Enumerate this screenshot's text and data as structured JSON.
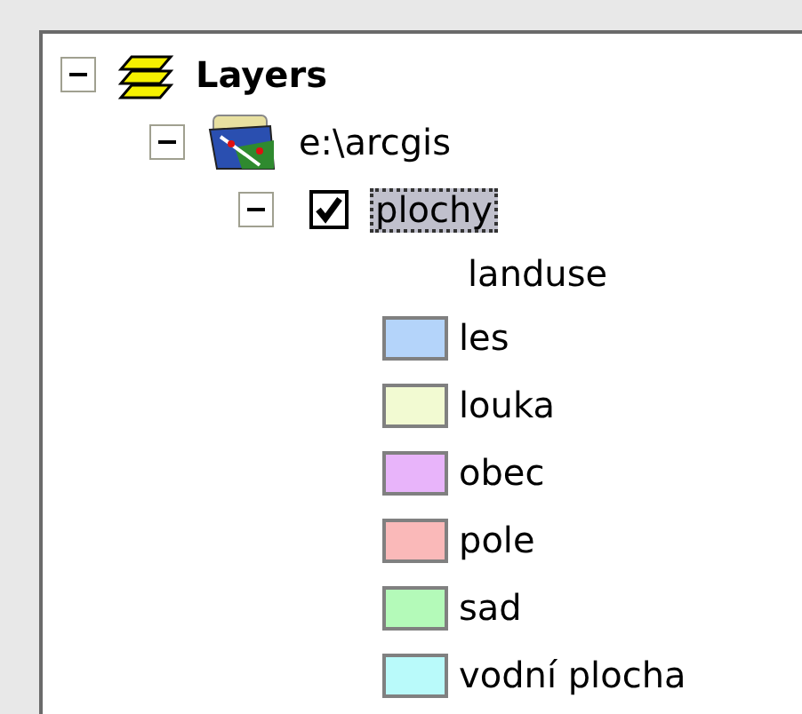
{
  "tree": [
    {
      "label": "Layers",
      "kind": "frame",
      "expanded": true,
      "children": [
        {
          "label": "e:\\arcgis",
          "kind": "workspace",
          "expanded": true,
          "children": [
            {
              "label": "plochy",
              "kind": "layer",
              "expanded": true,
              "checked": true,
              "selected": true,
              "legend": {
                "field": "landuse",
                "classes": [
                  {
                    "label": "les",
                    "color": "#b4d4fa"
                  },
                  {
                    "label": "louka",
                    "color": "#f2fad2"
                  },
                  {
                    "label": "obec",
                    "color": "#e8b4fa"
                  },
                  {
                    "label": "pole",
                    "color": "#fab9b9"
                  },
                  {
                    "label": "sad",
                    "color": "#b4fab9"
                  },
                  {
                    "label": "vodní plocha",
                    "color": "#b9fafa"
                  }
                ]
              }
            }
          ]
        }
      ]
    }
  ]
}
